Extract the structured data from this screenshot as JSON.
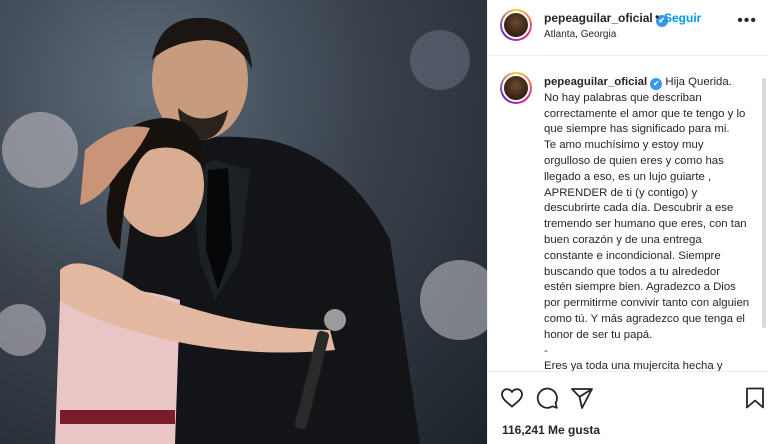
{
  "post": {
    "author": {
      "username": "pepeaguilar_oficial",
      "verified_mark": "✔",
      "avatar_icon": "profile-avatar"
    },
    "header": {
      "separator": "•",
      "follow_label": "Seguir",
      "location": "Atlanta, Georgia",
      "more_label": "•••"
    },
    "caption": {
      "username": "pepeaguilar_oficial",
      "lines": [
        "Hija Querida.",
        "No hay palabras que describan correctamente el amor que te tengo y lo que siempre has significado para mi.",
        "Te amo muchísimo y estoy muy orgulloso de quien eres y como has llegado a eso, es un lujo guiarte , APRENDER de ti (y contigo) y descubrirte cada día. Descubrir a ese tremendo ser humano que eres, con tan buen corazón y de una entrega constante e incondicional. Siempre buscando que todos a tu alrededor estén siempre bien. Agradezco a Dios por permitirme convivir tanto con alguien como tú. Y más agradezco que tenga el honor de ser tu papá.",
        "-",
        "Eres ya toda una mujercita hecha y derecha y..."
      ]
    },
    "actions": {
      "like_icon": "heart-icon",
      "comment_icon": "comment-icon",
      "share_icon": "share-icon",
      "save_icon": "bookmark-icon"
    },
    "likes_text": "116,241 Me gusta",
    "accent_colors": {
      "link": "#0095f6",
      "verified": "#3897f0",
      "text": "#262626",
      "border": "#efefef"
    }
  }
}
